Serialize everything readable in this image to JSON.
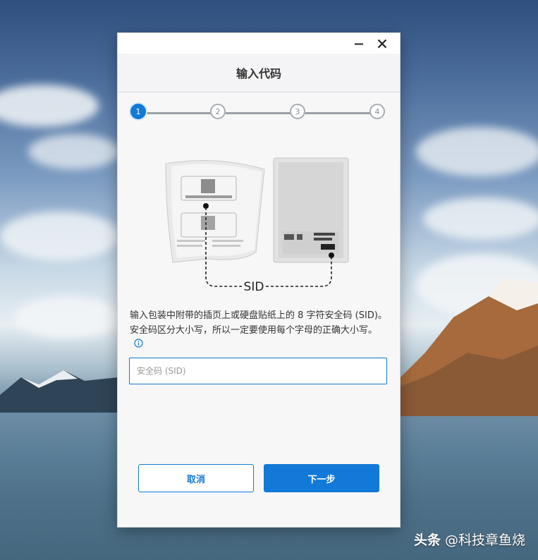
{
  "window": {
    "minimize_icon": "minimize-icon",
    "close_icon": "close-icon"
  },
  "header": {
    "title": "输入代码"
  },
  "stepper": {
    "steps": [
      "1",
      "2",
      "3",
      "4"
    ],
    "current": 1
  },
  "illustration": {
    "sid_label": "SID"
  },
  "instructions": {
    "text": "输入包装中附带的插页上或硬盘贴纸上的 8 字符安全码 (SID)。安全码区分大小写，所以一定要使用每个字母的正确大小写。"
  },
  "sid_input": {
    "placeholder": "安全码 (SID)",
    "value": ""
  },
  "buttons": {
    "cancel": "取消",
    "next": "下一步"
  },
  "watermark": {
    "brand": "头条",
    "handle": "@科技章鱼烧"
  },
  "colors": {
    "accent": "#1279d8",
    "step_inactive": "#a7acb1"
  }
}
